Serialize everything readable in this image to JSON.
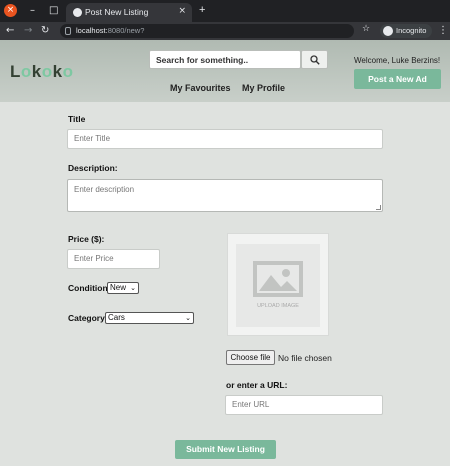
{
  "browser": {
    "tab_title": "Post New Listing",
    "new_tab": "+",
    "url_host": "localhost:",
    "url_path": "8080/new?",
    "incognito_label": "Incognito"
  },
  "header": {
    "logo": [
      "L",
      "o",
      "k",
      "o",
      "k",
      "o"
    ],
    "search_placeholder": "Search for something..",
    "nav": [
      "My Favourites",
      "My Profile"
    ],
    "welcome": "Welcome, Luke Berzins!",
    "post_ad": "Post a New Ad"
  },
  "form": {
    "title_label": "Title",
    "title_placeholder": "Enter Title",
    "description_label": "Description:",
    "description_placeholder": "Enter description",
    "price_label": "Price ($):",
    "price_placeholder": "Enter Price",
    "condition_label": "Condition:",
    "condition_value": "New",
    "category_label": "Category:",
    "category_value": "Cars",
    "upload_image_text": "UPLOAD IMAGE",
    "choose_file": "Choose file",
    "file_status": "No file chosen",
    "url_label": "or enter a URL:",
    "url_placeholder": "Enter URL",
    "submit": "Submit New Listing"
  },
  "colors": {
    "accent": "#7ab89b",
    "header_bg": "#b0bab2",
    "page_bg": "#dfe2df"
  }
}
